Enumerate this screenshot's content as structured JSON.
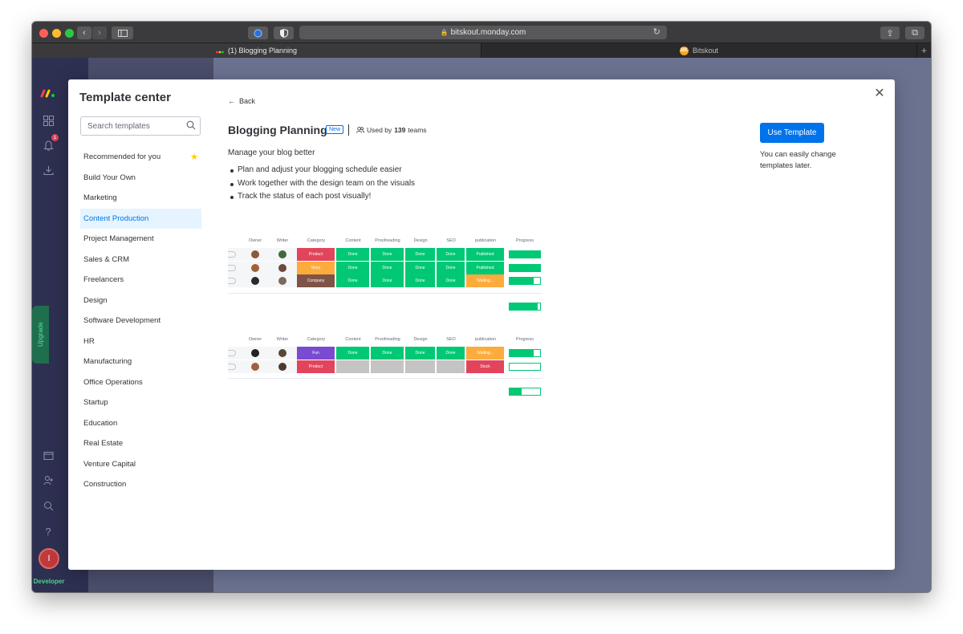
{
  "browser": {
    "address": "bitskout.monday.com",
    "tabs": [
      {
        "label": "(1) Blogging Planning"
      },
      {
        "label": "Bitskout",
        "badge": "BK"
      }
    ]
  },
  "sidenav": {
    "notification_count": "1",
    "upgrade_label": "Upgrade",
    "avatar_initial": "I",
    "developer_label": "Developer"
  },
  "template_center": {
    "title": "Template center",
    "search_placeholder": "Search templates",
    "categories": [
      {
        "label": "Recommended for you"
      },
      {
        "label": "Build Your Own"
      },
      {
        "label": "Marketing"
      },
      {
        "label": "Content Production"
      },
      {
        "label": "Project Management"
      },
      {
        "label": "Sales & CRM"
      },
      {
        "label": "Freelancers"
      },
      {
        "label": "Design"
      },
      {
        "label": "Software Development"
      },
      {
        "label": "HR"
      },
      {
        "label": "Manufacturing"
      },
      {
        "label": "Office Operations"
      },
      {
        "label": "Startup"
      },
      {
        "label": "Education"
      },
      {
        "label": "Real Estate"
      },
      {
        "label": "Venture Capital"
      },
      {
        "label": "Construction"
      }
    ],
    "active_category": "Content Production"
  },
  "template": {
    "back_label": "Back",
    "title": "Blogging Planning",
    "badge": "New",
    "used_prefix": "Used by",
    "used_count": "139",
    "used_suffix": "teams",
    "subtitle": "Manage your blog better",
    "bullets": [
      "Plan and adjust your blogging schedule easier",
      "Work together with the design team on the visuals",
      "Track the status of each post visually!"
    ],
    "use_button": "Use Template",
    "use_note": "You can easily change templates later."
  },
  "preview": {
    "columns": [
      "Owner",
      "Writer",
      "Category",
      "Content",
      "Proofreading",
      "Design",
      "SEO",
      "publication",
      "Progress"
    ],
    "groups": [
      {
        "rows": [
          {
            "category": "Product",
            "content": "Done",
            "proofreading": "Done",
            "design": "Done",
            "seo": "Done",
            "publication": "Published",
            "progress": 1.0
          },
          {
            "category": "Story",
            "content": "Done",
            "proofreading": "Done",
            "design": "Done",
            "seo": "Done",
            "publication": "Published",
            "progress": 1.0
          },
          {
            "category": "Company",
            "content": "Done",
            "proofreading": "Done",
            "design": "Done",
            "seo": "Done",
            "publication": "Waiting...",
            "progress": 0.8
          }
        ],
        "summary_progress": 0.93
      },
      {
        "rows": [
          {
            "category": "Fun",
            "content": "Done",
            "proofreading": "Done",
            "design": "Done",
            "seo": "Done",
            "publication": "Waiting...",
            "progress": 0.8
          },
          {
            "category": "Product",
            "content": "",
            "proofreading": "",
            "design": "",
            "seo": "",
            "publication": "Stuck",
            "progress": 0.0
          }
        ],
        "summary_progress": 0.4
      }
    ],
    "colors": {
      "Done": "#00c875",
      "Published": "#00c875",
      "Waiting...": "#fdab3d",
      "Stuck": "#e2445c",
      "": "#c4c4c4",
      "Product": "#e2445c",
      "Story": "#fdab3d",
      "Company": "#7f5347",
      "Fun": "#784bd1"
    }
  }
}
